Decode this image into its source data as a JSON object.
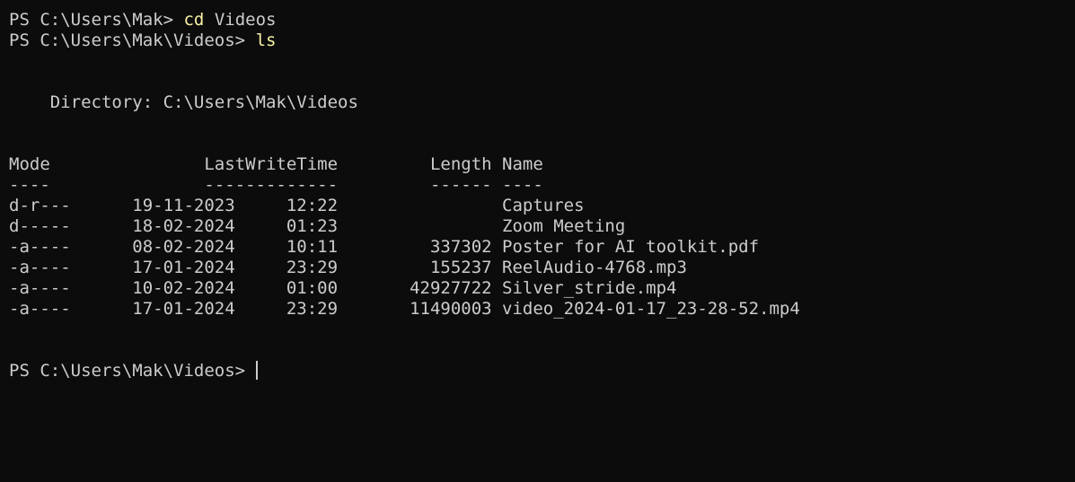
{
  "colors": {
    "background": "#0c0c0c",
    "foreground": "#cccccc",
    "command": "#f9f1a5"
  },
  "history": [
    {
      "prompt": "PS C:\\Users\\Mak>",
      "command": "cd",
      "argument": "Videos"
    },
    {
      "prompt": "PS C:\\Users\\Mak\\Videos>",
      "command": "ls",
      "argument": ""
    }
  ],
  "directory_line": "Directory: C:\\Users\\Mak\\Videos",
  "table": {
    "headers": {
      "mode": "Mode",
      "lastwrite": "LastWriteTime",
      "length": "Length",
      "name": "Name"
    },
    "underlines": {
      "mode": "----",
      "lastwrite": "-------------",
      "length": "------",
      "name": "----"
    },
    "rows": [
      {
        "mode": "d-r---",
        "date": "19-11-2023",
        "time": "12:22",
        "length": "",
        "name": "Captures"
      },
      {
        "mode": "d-----",
        "date": "18-02-2024",
        "time": "01:23",
        "length": "",
        "name": "Zoom Meeting"
      },
      {
        "mode": "-a----",
        "date": "08-02-2024",
        "time": "10:11",
        "length": "337302",
        "name": "Poster for AI toolkit.pdf"
      },
      {
        "mode": "-a----",
        "date": "17-01-2024",
        "time": "23:29",
        "length": "155237",
        "name": "ReelAudio-4768.mp3"
      },
      {
        "mode": "-a----",
        "date": "10-02-2024",
        "time": "01:00",
        "length": "42927722",
        "name": "Silver_stride.mp4"
      },
      {
        "mode": "-a----",
        "date": "17-01-2024",
        "time": "23:29",
        "length": "11490003",
        "name": "video_2024-01-17_23-28-52.mp4"
      }
    ]
  },
  "current_prompt": "PS C:\\Users\\Mak\\Videos>"
}
